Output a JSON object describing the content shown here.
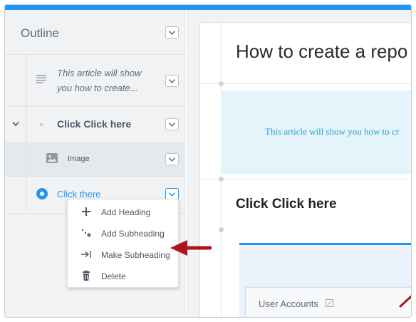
{
  "sidebar": {
    "title": "Outline",
    "intro_text": "This article will show you how to create...",
    "heading": "Click Click here",
    "image_label": "Image",
    "selected_item": "Click there"
  },
  "menu": {
    "items": [
      {
        "label": "Add Heading",
        "icon": "plus-icon"
      },
      {
        "label": "Add Subheading",
        "icon": "add-subheading-icon"
      },
      {
        "label": "Make Subheading",
        "icon": "indent-arrow-icon"
      },
      {
        "label": "Delete",
        "icon": "trash-icon"
      }
    ]
  },
  "content": {
    "title": "How to create a repo",
    "intro_text": "This article will show you how to cr",
    "section_heading": "Click Click here",
    "screenshot_label": "User Accounts"
  },
  "colors": {
    "accent": "#2196f3",
    "annotation_arrow": "#b0141b"
  }
}
